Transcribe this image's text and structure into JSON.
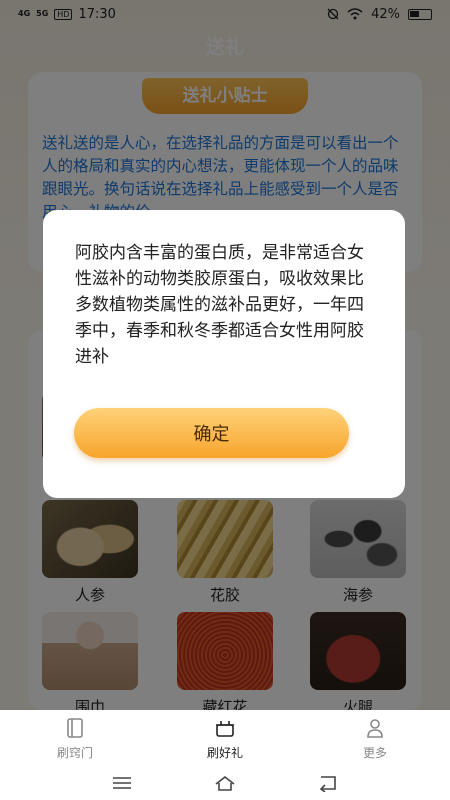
{
  "status_bar": {
    "signal_1": "4G",
    "signal_2": "5G",
    "hd": "HD",
    "time": "17:30",
    "battery": "42%",
    "icons": [
      "sim-signal-icon",
      "silent-icon",
      "wifi-icon",
      "battery-icon"
    ]
  },
  "header": {
    "title": "送礼"
  },
  "tips": {
    "banner": "送礼小贴士",
    "text": "送礼送的是人心，在选择礼品的方面是可以看出一个人的格局和真实的内心想法，更能体现一个人的品味跟眼光。换句话说在选择礼品上能感受到一个人是否用心，礼物的价"
  },
  "gifts": [
    {
      "label": "人参",
      "image": "ginseng"
    },
    {
      "label": "花胶",
      "image": "fish-maw"
    },
    {
      "label": "海参",
      "image": "sea-cucumber"
    },
    {
      "label": "围巾",
      "image": "scarf"
    },
    {
      "label": "藏红花",
      "image": "saffron"
    },
    {
      "label": "火腿",
      "image": "ham"
    }
  ],
  "dialog": {
    "text": "阿胶内含丰富的蛋白质，是非常适合女性滋补的动物类胶原蛋白，吸收效果比多数植物类属性的滋补品更好，一年四季中，春季和秋冬季都适合女性用阿胶进补",
    "confirm_label": "确定"
  },
  "tabbar": {
    "items": [
      {
        "label": "刷窍门",
        "icon": "book-icon",
        "active": false
      },
      {
        "label": "刷好礼",
        "icon": "gift-box-icon",
        "active": true
      },
      {
        "label": "更多",
        "icon": "person-icon",
        "active": false
      }
    ]
  },
  "colors": {
    "accent": "#f7a52c",
    "tips_text": "#1f74d8",
    "overlay": "rgba(0,0,0,0.5)"
  }
}
